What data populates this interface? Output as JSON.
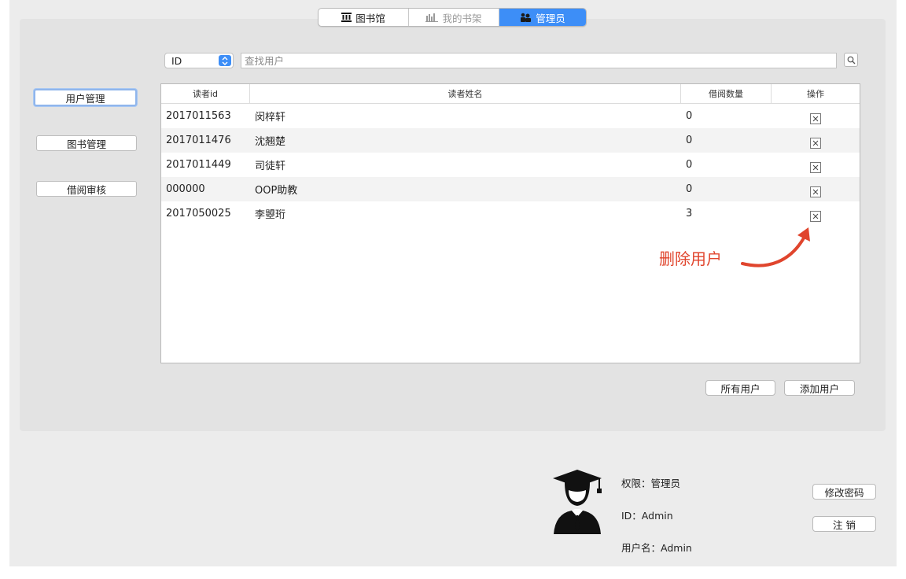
{
  "tabs": [
    {
      "label": "图书馆",
      "icon": "library-icon"
    },
    {
      "label": "我的书架",
      "icon": "bookshelf-icon"
    },
    {
      "label": "管理员",
      "icon": "admin-icon"
    }
  ],
  "sidebar": {
    "items": [
      {
        "label": "用户管理"
      },
      {
        "label": "图书管理"
      },
      {
        "label": "借阅审核"
      }
    ]
  },
  "search": {
    "field_selected": "ID",
    "placeholder": "查找用户",
    "value": ""
  },
  "table": {
    "headers": [
      "读者id",
      "读者姓名",
      "借阅数量",
      "操作"
    ],
    "rows": [
      {
        "id": "2017011563",
        "name": "闵梓轩",
        "count": "0"
      },
      {
        "id": "2017011476",
        "name": "沈翘楚",
        "count": "0"
      },
      {
        "id": "2017011449",
        "name": "司徒轩",
        "count": "0"
      },
      {
        "id": "000000",
        "name": "OOP助教",
        "count": "0"
      },
      {
        "id": "2017050025",
        "name": "李曌珩",
        "count": "3"
      }
    ]
  },
  "annotation": {
    "text": "删除用户",
    "color": "#e0452d"
  },
  "actions": {
    "all_users": "所有用户",
    "add_user": "添加用户"
  },
  "profile": {
    "permission": "权限：管理员",
    "id": "ID：Admin",
    "username": "用户名：Admin",
    "change_password": "修改密码",
    "logout": "注 销"
  },
  "colors": {
    "accent": "#3d8ef7",
    "panel": "#e3e3e3",
    "window": "#ececec"
  }
}
